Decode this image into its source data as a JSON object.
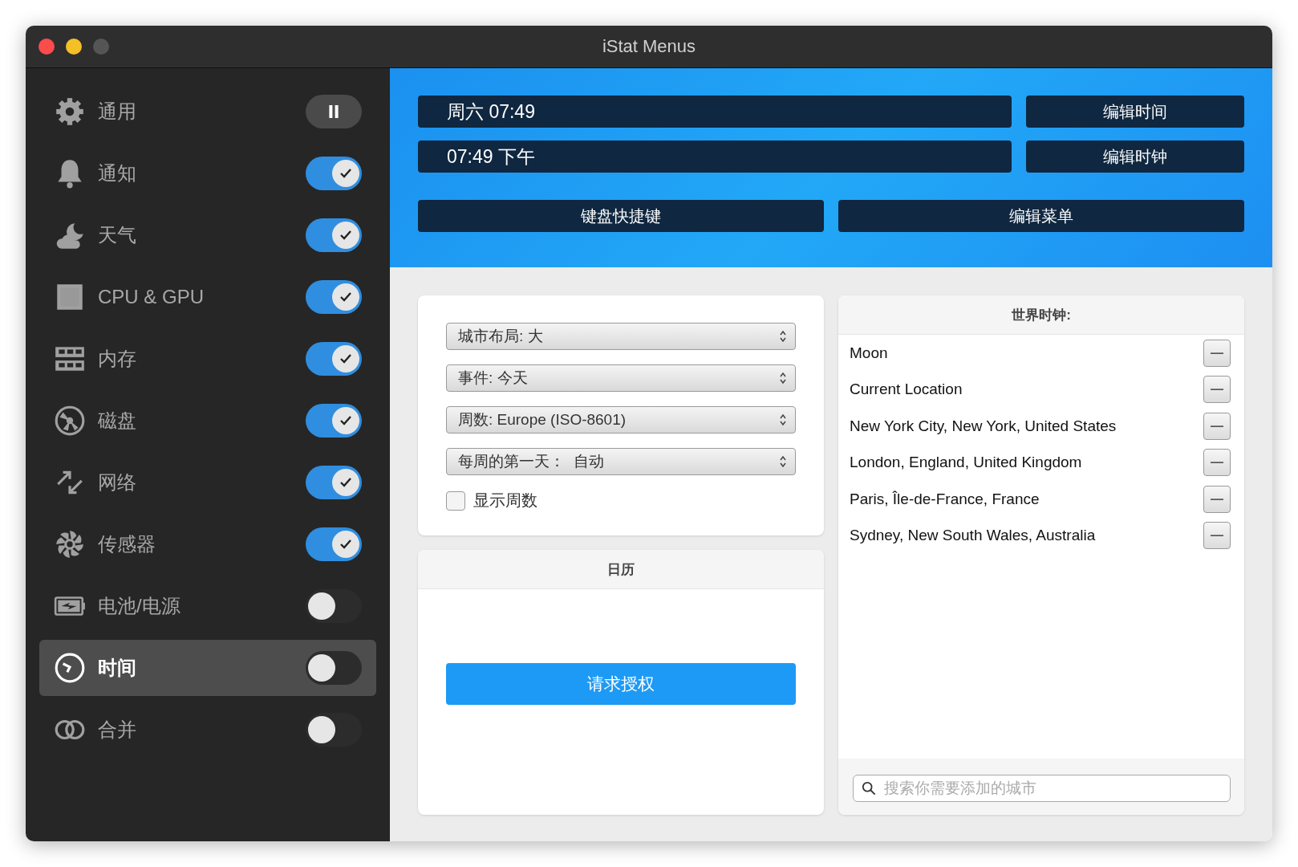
{
  "window": {
    "title": "iStat Menus"
  },
  "sidebar": {
    "items": [
      {
        "label": "通用",
        "kind": "pause",
        "on": true,
        "selected": false
      },
      {
        "label": "通知",
        "kind": "toggle",
        "on": true,
        "selected": false
      },
      {
        "label": "天气",
        "kind": "toggle",
        "on": true,
        "selected": false
      },
      {
        "label": "CPU & GPU",
        "kind": "toggle",
        "on": true,
        "selected": false
      },
      {
        "label": "内存",
        "kind": "toggle",
        "on": true,
        "selected": false
      },
      {
        "label": "磁盘",
        "kind": "toggle",
        "on": true,
        "selected": false
      },
      {
        "label": "网络",
        "kind": "toggle",
        "on": true,
        "selected": false
      },
      {
        "label": "传感器",
        "kind": "toggle",
        "on": true,
        "selected": false
      },
      {
        "label": "电池/电源",
        "kind": "toggle",
        "on": false,
        "selected": false
      },
      {
        "label": "时间",
        "kind": "toggle",
        "on": false,
        "selected": true
      },
      {
        "label": "合并",
        "kind": "toggle",
        "on": false,
        "selected": false
      }
    ]
  },
  "header": {
    "formats": [
      {
        "value": "周六 07:49",
        "button": "编辑时间"
      },
      {
        "value": "07:49 下午",
        "button": "编辑时钟"
      }
    ],
    "buttons": [
      "键盘快捷键",
      "编辑菜单"
    ]
  },
  "options": {
    "selects": [
      "城市布局: 大",
      "事件: 今天",
      "周数: Europe (ISO-8601)",
      "每周的第一天：  自动"
    ],
    "checkbox": {
      "label": "显示周数",
      "checked": false
    }
  },
  "calendar": {
    "title": "日历",
    "button": "请求授权"
  },
  "world_clock": {
    "title": "世界时钟:",
    "cities": [
      "Moon",
      "Current Location",
      "New York City, New York, United States",
      "London, England, United Kingdom",
      "Paris, Île-de-France, France",
      "Sydney, New South Wales, Australia"
    ],
    "remove_symbol": "—",
    "search": {
      "placeholder": "搜索你需要添加的城市"
    }
  }
}
